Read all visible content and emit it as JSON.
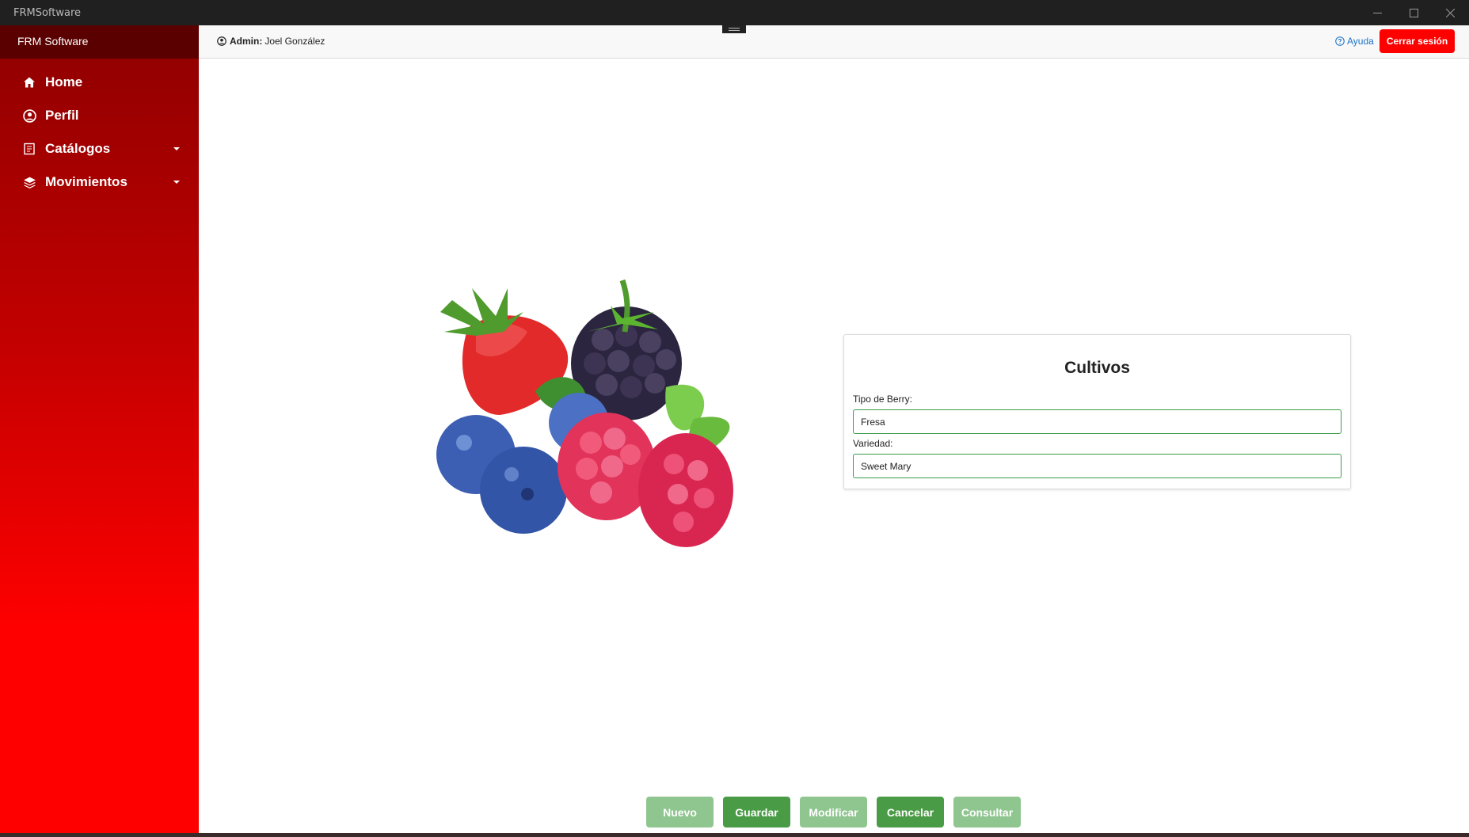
{
  "window": {
    "title": "FRMSoftware"
  },
  "sidebar": {
    "brand": "FRM Software",
    "items": [
      {
        "label": "Home",
        "icon": "home-icon",
        "has_dropdown": false
      },
      {
        "label": "Perfil",
        "icon": "user-circle-icon",
        "has_dropdown": false
      },
      {
        "label": "Catálogos",
        "icon": "catalog-icon",
        "has_dropdown": true
      },
      {
        "label": "Movimientos",
        "icon": "layers-icon",
        "has_dropdown": true
      }
    ]
  },
  "topbar": {
    "role": "Admin:",
    "user_name": "Joel González",
    "help_label": "Ayuda",
    "logout_label": "Cerrar sesión"
  },
  "form": {
    "title": "Cultivos",
    "berry_type_label": "Tipo de Berry:",
    "berry_type_value": "Fresa",
    "variety_label": "Variedad:",
    "variety_value": "Sweet Mary"
  },
  "actions": {
    "new_label": "Nuevo",
    "save_label": "Guardar",
    "modify_label": "Modificar",
    "cancel_label": "Cancelar",
    "query_label": "Consultar"
  },
  "colors": {
    "sidebar_top": "#8e0000",
    "sidebar_bottom": "#ff0000",
    "logout": "#ff0000",
    "button_enabled": "#4a9b45",
    "button_disabled": "#8fc58f",
    "input_border": "#3a9c4a",
    "help_link": "#1a73c8"
  }
}
